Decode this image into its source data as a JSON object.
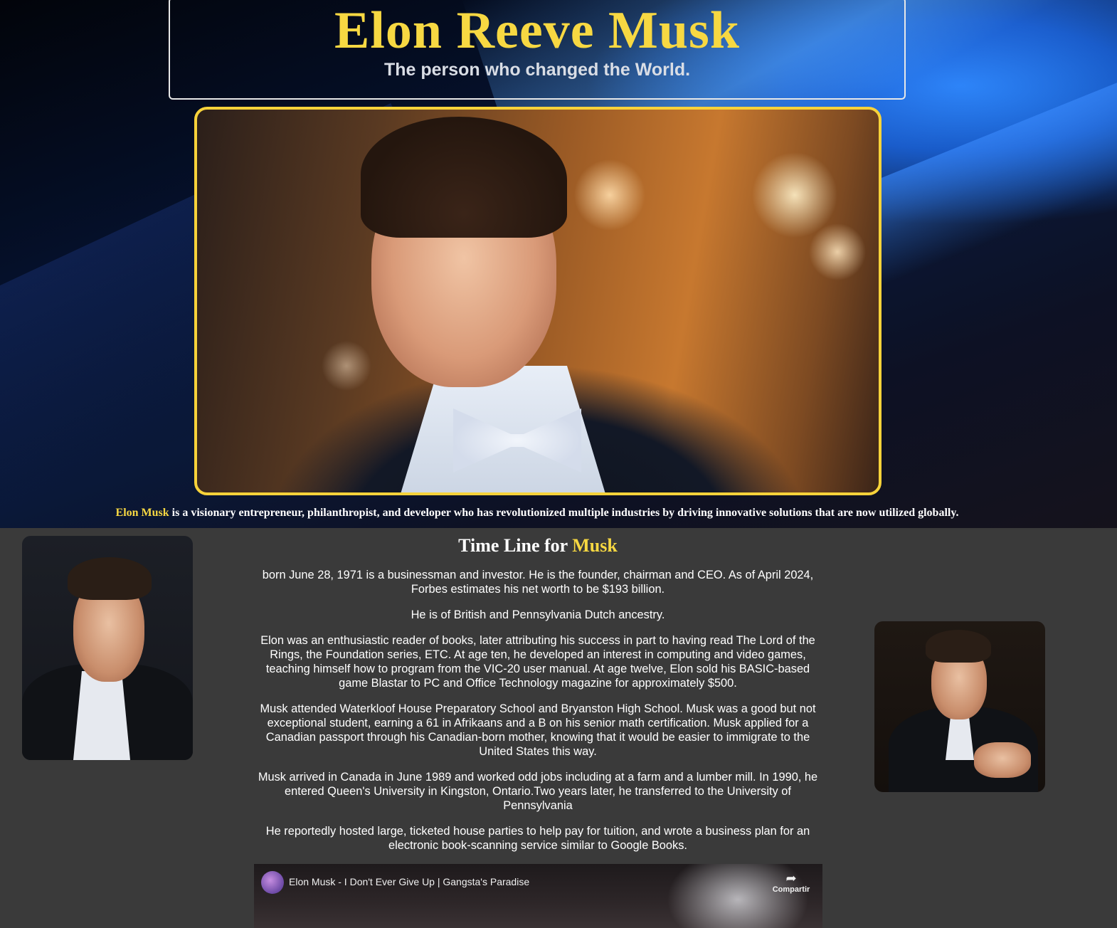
{
  "hero": {
    "title": "Elon Reeve Musk",
    "subtitle": "The person who changed the World.",
    "photo_alt": "Elon Musk in tuxedo with white bow tie",
    "caption_highlight": "Elon Musk",
    "caption_text": " is a visionary entrepreneur, philanthropist, and developer who has revolutionized multiple industries by driving innovative solutions that are now utilized globally."
  },
  "timeline": {
    "heading_prefix": "Time Line for ",
    "heading_highlight": "Musk",
    "paragraphs": [
      "born June 28, 1971 is a businessman and investor. He is the founder, chairman and CEO. As of April 2024, Forbes estimates his net worth to be $193 billion.",
      "He is of British and Pennsylvania Dutch ancestry.",
      "Elon was an enthusiastic reader of books, later attributing his success in part to having read The Lord of the Rings, the Foundation series, ETC. At age ten, he developed an interest in computing and video games, teaching himself how to program from the VIC-20 user manual. At age twelve, Elon sold his BASIC-based game Blastar to PC and Office Technology magazine for approximately $500.",
      "Musk attended Waterkloof House Preparatory School and Bryanston High School. Musk was a good but not exceptional student, earning a 61 in Afrikaans and a B on his senior math certification. Musk applied for a Canadian passport through his Canadian-born mother, knowing that it would be easier to immigrate to the United States this way.",
      "Musk arrived in Canada in June 1989 and worked odd jobs including at a farm and a lumber mill. In 1990, he entered Queen's University in Kingston, Ontario.Two years later, he transferred to the University of Pennsylvania",
      "He reportedly hosted large, ticketed house parties to help pay for tuition, and wrote a business plan for an electronic book-scanning service similar to Google Books."
    ]
  },
  "video": {
    "title": "Elon Musk - I Don't Ever Give Up | Gangsta's Paradise",
    "share_label": "Compartir",
    "share_icon": "share-arrow-icon"
  },
  "colors": {
    "accent": "#f7d842",
    "content_bg": "#3a3a3a",
    "photo_border": "#f7d23a"
  }
}
